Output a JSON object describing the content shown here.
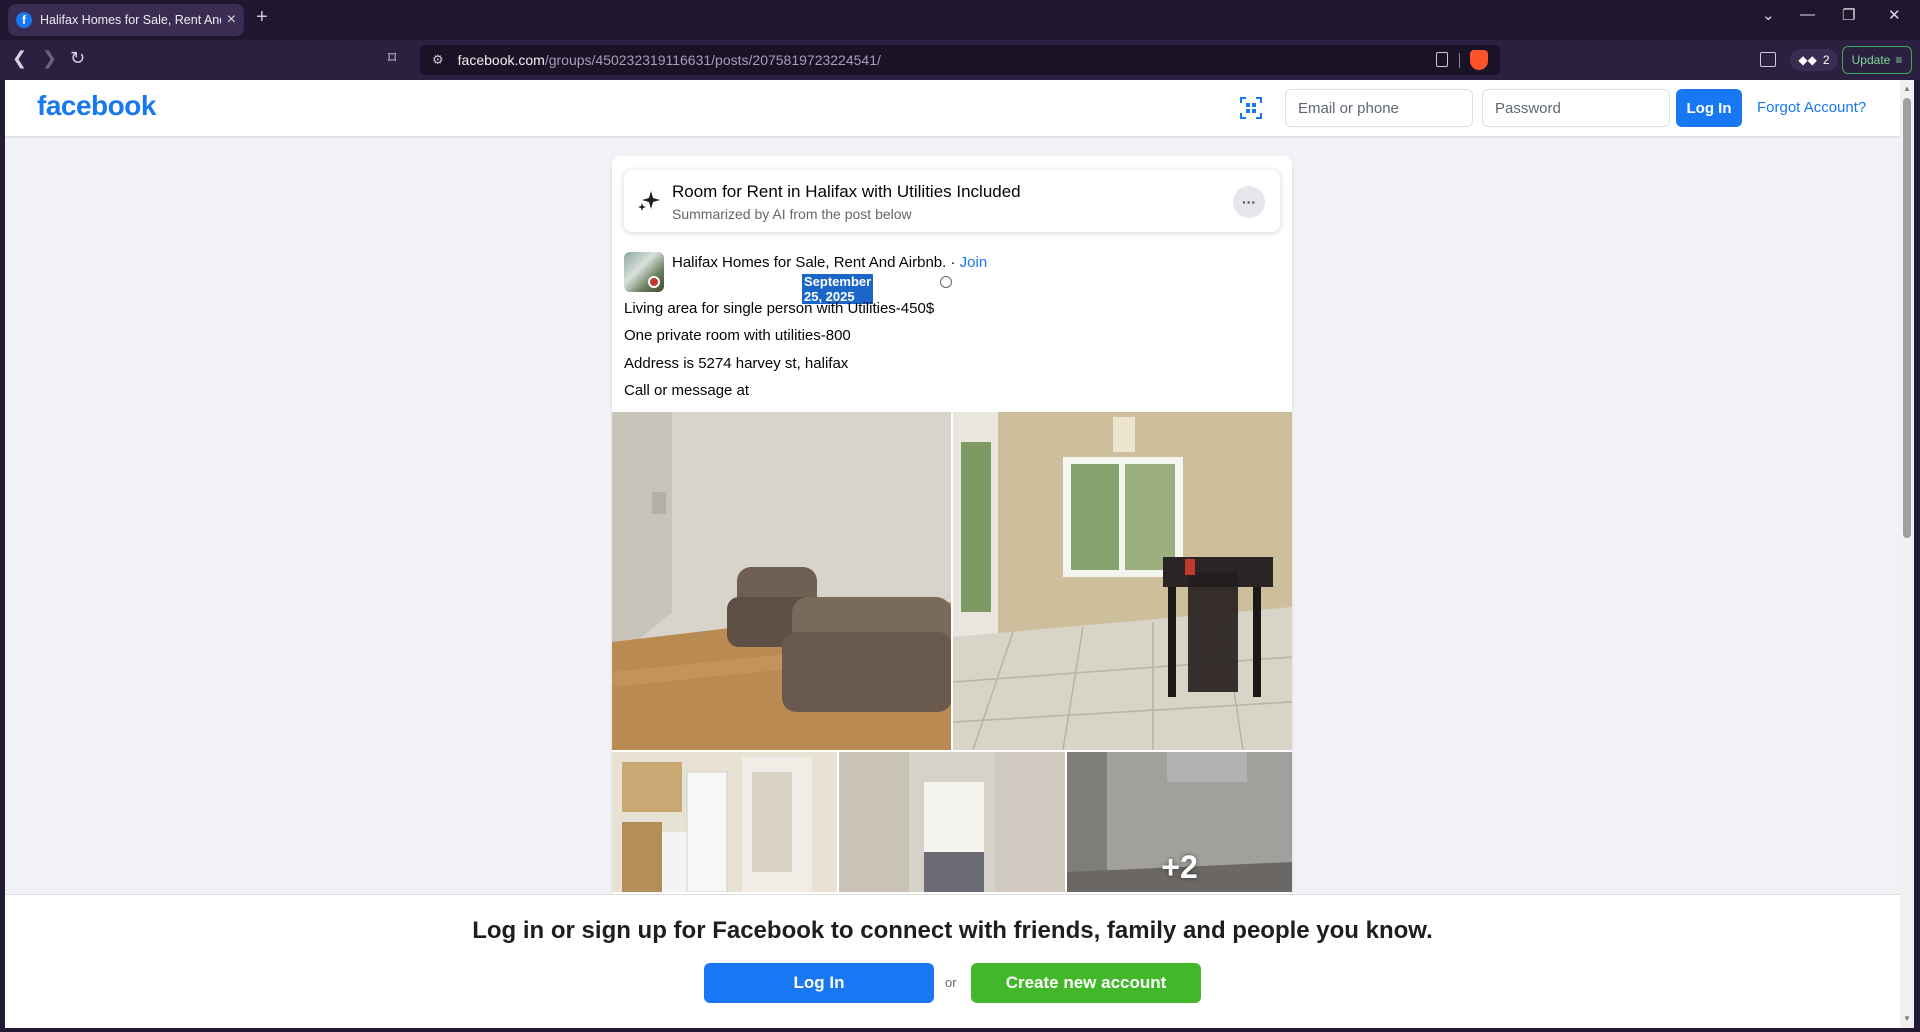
{
  "browser": {
    "tab_title": "Halifax Homes for Sale, Rent And Airbnb",
    "url_host": "facebook.com",
    "url_path": "/groups/450232319116631/posts/2075819723224541/",
    "wallet_count": "2",
    "update_label": "Update"
  },
  "header": {
    "logo": "facebook",
    "email_placeholder": "Email or phone",
    "password_placeholder": "Password",
    "login_label": "Log In",
    "forgot_label": "Forgot Account?"
  },
  "post": {
    "ai_title": "Room for Rent in Halifax with Utilities Included",
    "ai_subtitle": "Summarized by AI from the post below",
    "more_label": "···",
    "group_name": "Halifax Homes for Sale, Rent And Airbnb.",
    "join_separator": " · ",
    "join_label": "Join",
    "date": "September 25, 2025",
    "body": [
      "Living area for single person with Utilities-450$",
      "One private room with utilities-800",
      "Address is 5274 harvey st, halifax",
      "Call or message at"
    ],
    "more_photos": "+2"
  },
  "banner": {
    "text": "Log in or sign up for Facebook to connect with friends, family and people you know.",
    "login_label": "Log In",
    "or_label": "or",
    "create_label": "Create new account"
  },
  "colors": {
    "fb_blue": "#1877f2",
    "create_green": "#42b72a",
    "browser_chrome": "#2b2040"
  }
}
